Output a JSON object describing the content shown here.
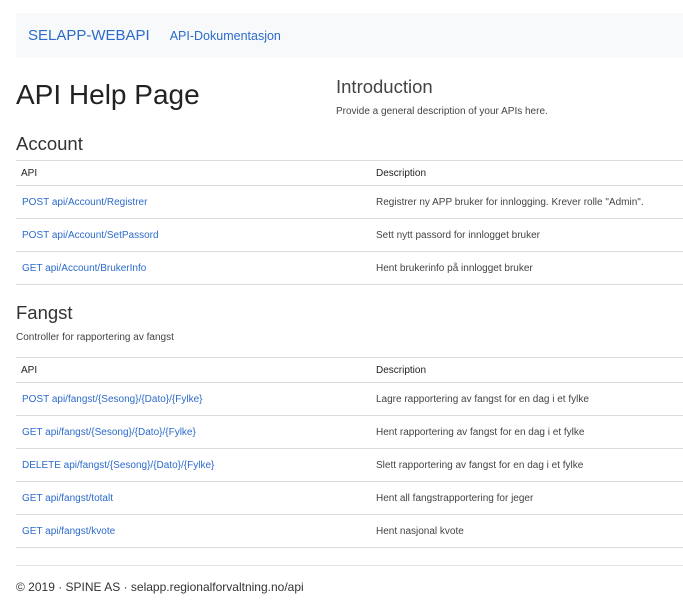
{
  "navbar": {
    "brand": "SELAPP-WEBAPI",
    "link": "API-Dokumentasjon"
  },
  "page_title": "API Help Page",
  "intro": {
    "title": "Introduction",
    "text": "Provide a general description of your APIs here."
  },
  "sections": [
    {
      "title": "Account",
      "description": "",
      "headers": {
        "api": "API",
        "description": "Description"
      },
      "rows": [
        {
          "api": "POST api/Account/Registrer",
          "description": "Registrer ny APP bruker for innlogging. Krever rolle \"Admin\"."
        },
        {
          "api": "POST api/Account/SetPassord",
          "description": "Sett nytt passord for innlogget bruker"
        },
        {
          "api": "GET api/Account/BrukerInfo",
          "description": "Hent brukerinfo på innlogget bruker"
        }
      ]
    },
    {
      "title": "Fangst",
      "description": "Controller for rapportering av fangst",
      "headers": {
        "api": "API",
        "description": "Description"
      },
      "rows": [
        {
          "api": "POST api/fangst/{Sesong}/{Dato}/{Fylke}",
          "description": "Lagre rapportering av fangst for en dag i et fylke"
        },
        {
          "api": "GET api/fangst/{Sesong}/{Dato}/{Fylke}",
          "description": "Hent rapportering av fangst for en dag i et fylke"
        },
        {
          "api": "DELETE api/fangst/{Sesong}/{Dato}/{Fylke}",
          "description": "Slett rapportering av fangst for en dag i et fylke"
        },
        {
          "api": "GET api/fangst/totalt",
          "description": "Hent all fangstrapportering for jeger"
        },
        {
          "api": "GET api/fangst/kvote",
          "description": "Hent nasjonal kvote"
        }
      ]
    }
  ],
  "footer": "© 2019 · SPINE AS · selapp.regionalforvaltning.no/api"
}
